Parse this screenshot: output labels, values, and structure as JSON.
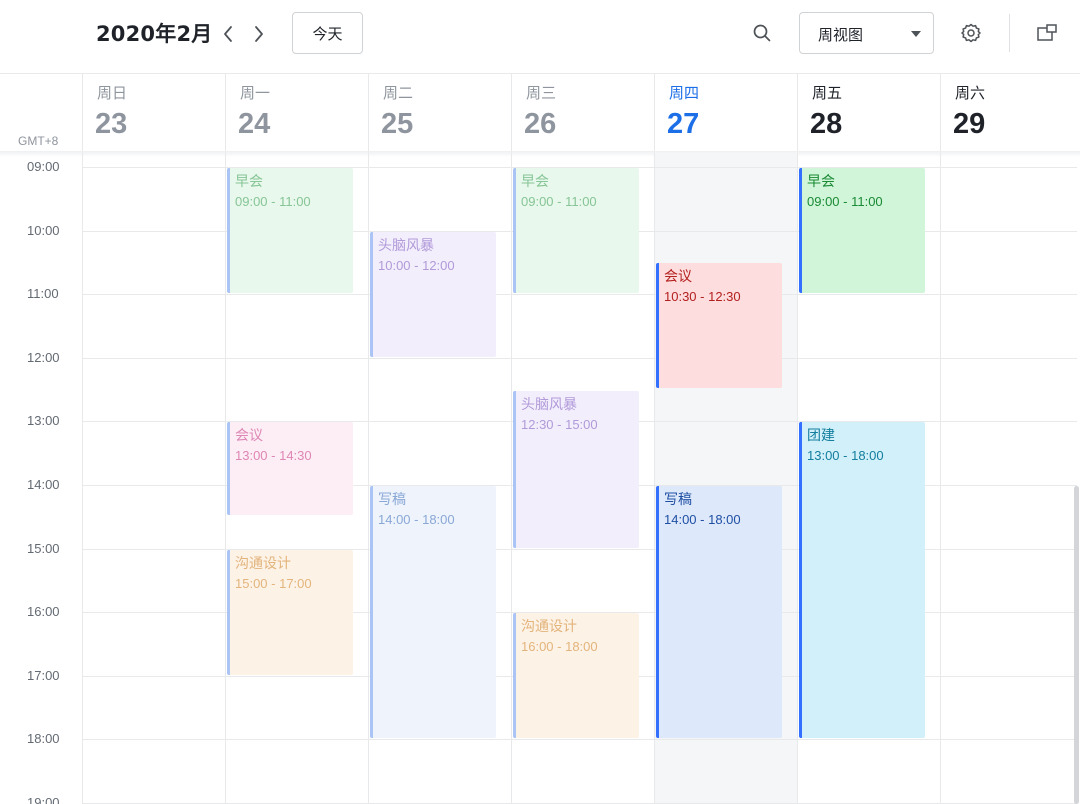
{
  "toolbar": {
    "month_title": "2020年2月",
    "today_label": "今天",
    "view_selected": "周视图",
    "icons": [
      "chevron-left-icon",
      "chevron-right-icon",
      "search-icon",
      "gear-icon",
      "window-icon"
    ]
  },
  "timezone": "GMT+8",
  "days": [
    {
      "dow": "周日",
      "num": "23",
      "state": "past"
    },
    {
      "dow": "周一",
      "num": "24",
      "state": "past"
    },
    {
      "dow": "周二",
      "num": "25",
      "state": "past"
    },
    {
      "dow": "周三",
      "num": "26",
      "state": "past"
    },
    {
      "dow": "周四",
      "num": "27",
      "state": "today"
    },
    {
      "dow": "周五",
      "num": "28",
      "state": "future"
    },
    {
      "dow": "周六",
      "num": "29",
      "state": "future"
    }
  ],
  "hours": [
    "09:00",
    "10:00",
    "11:00",
    "12:00",
    "13:00",
    "14:00",
    "15:00",
    "16:00",
    "17:00",
    "18:00",
    "19:00"
  ],
  "events": [
    {
      "day": 1,
      "title": "早会",
      "time": "09:00 - 11:00",
      "start": 9,
      "end": 11,
      "color": "green",
      "past": true
    },
    {
      "day": 1,
      "title": "会议",
      "time": "13:00 - 14:30",
      "start": 13,
      "end": 14.5,
      "color": "pink",
      "past": true
    },
    {
      "day": 1,
      "title": "沟通设计",
      "time": "15:00 - 17:00",
      "start": 15,
      "end": 17,
      "color": "orange",
      "past": true
    },
    {
      "day": 2,
      "title": "头脑风暴",
      "time": "10:00 - 12:00",
      "start": 10,
      "end": 12,
      "color": "purple",
      "past": true
    },
    {
      "day": 2,
      "title": "写稿",
      "time": "14:00 - 18:00",
      "start": 14,
      "end": 18,
      "color": "blue",
      "past": true
    },
    {
      "day": 3,
      "title": "早会",
      "time": "09:00 - 11:00",
      "start": 9,
      "end": 11,
      "color": "green",
      "past": true
    },
    {
      "day": 3,
      "title": "头脑风暴",
      "time": "12:30 - 15:00",
      "start": 12.5,
      "end": 15,
      "color": "purple",
      "past": true
    },
    {
      "day": 3,
      "title": "沟通设计",
      "time": "16:00 - 18:00",
      "start": 16,
      "end": 18,
      "color": "orange",
      "past": true
    },
    {
      "day": 4,
      "title": "会议",
      "time": "10:30 - 12:30",
      "start": 10.5,
      "end": 12.5,
      "color": "red",
      "past": false
    },
    {
      "day": 4,
      "title": "写稿",
      "time": "14:00 - 18:00",
      "start": 14,
      "end": 18,
      "color": "blue",
      "past": false
    },
    {
      "day": 5,
      "title": "早会",
      "time": "09:00 - 11:00",
      "start": 9,
      "end": 11,
      "color": "green",
      "past": false
    },
    {
      "day": 5,
      "title": "团建",
      "time": "13:00 - 18:00",
      "start": 13,
      "end": 18,
      "color": "cyan",
      "past": false
    }
  ],
  "palette": {
    "green": {
      "bg": "#d0f5d8",
      "bar": "#3370ff",
      "text": "#1a8a35",
      "past_bg": "#e9f8ec",
      "past_text": "#86c596"
    },
    "pink": {
      "bg": "#fde3ef",
      "bar": "#3370ff",
      "text": "#c2307a",
      "past_bg": "#fdeef5",
      "past_text": "#de86b4"
    },
    "orange": {
      "bg": "#fde8d2",
      "bar": "#3370ff",
      "text": "#c97a1e",
      "past_bg": "#fdf2e6",
      "past_text": "#e3b47c"
    },
    "purple": {
      "bg": "#ece3fc",
      "bar": "#3370ff",
      "text": "#7b52c9",
      "past_bg": "#f3eefc",
      "past_text": "#b09ad9"
    },
    "blue": {
      "bg": "#dde8fb",
      "bar": "#3370ff",
      "text": "#1f4fa3",
      "past_bg": "#eef3fc",
      "past_text": "#8aa8d6"
    },
    "red": {
      "bg": "#fddddd",
      "bar": "#3370ff",
      "text": "#b32020",
      "past_bg": "#fdeaea",
      "past_text": "#e08a8a"
    },
    "cyan": {
      "bg": "#d2f0fa",
      "bar": "#3370ff",
      "text": "#137e9e",
      "past_bg": "#e6f6fb",
      "past_text": "#7fc2d6"
    }
  },
  "accent": "#1d6fe8"
}
